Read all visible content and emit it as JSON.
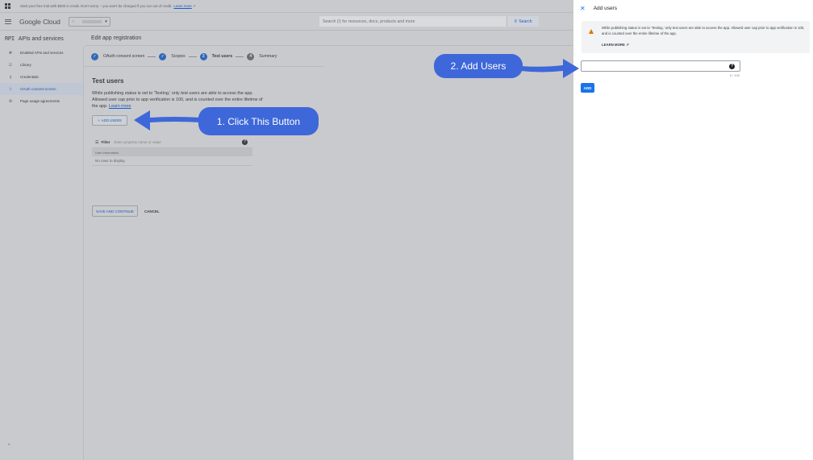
{
  "promo": {
    "text": "Start your free trial with $300 in credit. Don't worry – you won't be charged if you run out of credit.",
    "link": "Learn more"
  },
  "topbar": {
    "logo": "Google Cloud",
    "search_placeholder": "Search (/) for resources, docs, products and more",
    "search_button": "Search"
  },
  "sidebar": {
    "badge": "RPI",
    "title": "APIs and services",
    "items": [
      {
        "label": "Enabled APIs and services",
        "icon": "✥"
      },
      {
        "label": "Library",
        "icon": "☷"
      },
      {
        "label": "Credentials",
        "icon": "⚷"
      },
      {
        "label": "OAuth consent screen",
        "icon": "⁝⁝"
      },
      {
        "label": "Page usage agreements",
        "icon": "⚙"
      }
    ],
    "collapse_icon": "«"
  },
  "main": {
    "title": "Edit app registration",
    "steps": [
      {
        "label": "OAuth consent screen",
        "marker": "✓"
      },
      {
        "label": "Scopes",
        "marker": "✓"
      },
      {
        "label": "Test users",
        "marker": "3"
      },
      {
        "label": "Summary",
        "marker": "4"
      }
    ],
    "heading": "Test users",
    "description": "While publishing status is set to 'Testing,' only test users are able to access the app. Allowed user cap prior to app verification is 100, and is counted over the entire lifetime of the app.",
    "learn_more": "Learn more",
    "add_users_button": "ADD USERS",
    "filter_label": "Filter",
    "filter_placeholder": "Enter property name or value",
    "table_header": "User information",
    "empty_text": "No rows to display",
    "save_button": "SAVE AND CONTINUE",
    "cancel_button": "CANCEL"
  },
  "annotations": {
    "step1": "1. Click This Button",
    "step2": "2. Add Users"
  },
  "panel": {
    "title": "Add users",
    "warning": "While publishing status is set to 'Testing,' only test users are able to access the app. Allowed user cap prior to app verification is 100, and is counted over the entire lifetime of the app.",
    "learn_more": "LEARN MORE",
    "char_count": "0 / 100",
    "add_button": "ADD"
  },
  "colors": {
    "accent": "#1a73e8",
    "annotation": "#3e67d9",
    "warning": "#e37400"
  }
}
